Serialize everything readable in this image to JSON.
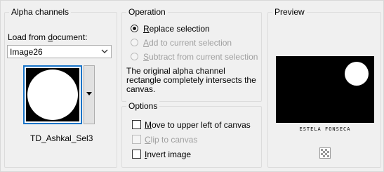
{
  "alpha": {
    "title": "Alpha channels",
    "load_label_pre": "Load from ",
    "load_label_u": "d",
    "load_label_post": "ocument:",
    "document_value": "Image26",
    "channel_name": "TD_Ashkal_Sel3"
  },
  "operation": {
    "title": "Operation",
    "replace": {
      "u": "R",
      "rest": "eplace selection",
      "selected": true
    },
    "add": {
      "u": "A",
      "rest": "dd to current selection",
      "enabled": false
    },
    "subtract": {
      "u": "S",
      "rest": "ubtract from current selection",
      "enabled": false
    },
    "description": "The original alpha channel rectangle completely intersects the canvas."
  },
  "options": {
    "title": "Options",
    "move": {
      "u": "M",
      "rest": "ove to upper left of canvas",
      "checked": false
    },
    "clip": {
      "u": "C",
      "rest": "lip to canvas",
      "checked": false,
      "enabled": false
    },
    "invert": {
      "u": "I",
      "rest": "nvert image",
      "checked": false
    }
  },
  "preview": {
    "title": "Preview",
    "watermark": "ESTELA FONSECA"
  },
  "icons": {
    "select_arrow": "chevron-down-icon",
    "dropdown": "triangle-down-icon",
    "zoom": "checker-zoom-icon"
  }
}
